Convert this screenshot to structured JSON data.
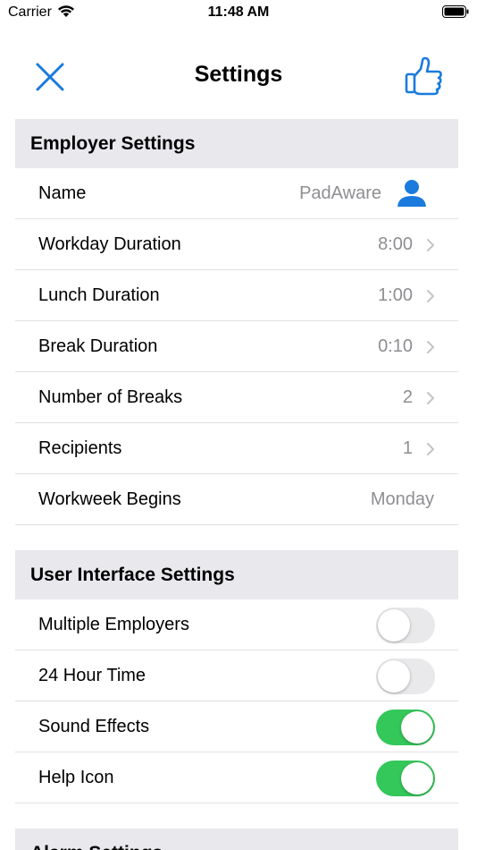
{
  "status_bar": {
    "carrier": "Carrier",
    "time": "11:48 AM"
  },
  "nav": {
    "title": "Settings",
    "close_icon": "close-icon",
    "like_icon": "thumbs-up-icon",
    "accent": "#1a7bdc"
  },
  "employer": {
    "header": "Employer Settings",
    "rows": [
      {
        "label": "Name",
        "value": "PadAware"
      },
      {
        "label": "Workday Duration",
        "value": "8:00"
      },
      {
        "label": "Lunch Duration",
        "value": "1:00"
      },
      {
        "label": "Break Duration",
        "value": "0:10"
      },
      {
        "label": "Number of Breaks",
        "value": "2"
      },
      {
        "label": "Recipients",
        "value": "1"
      },
      {
        "label": "Workweek Begins",
        "value": "Monday"
      }
    ]
  },
  "ui": {
    "header": "User Interface Settings",
    "rows": [
      {
        "label": "Multiple Employers",
        "on": false
      },
      {
        "label": "24 Hour Time",
        "on": false
      },
      {
        "label": "Sound Effects",
        "on": true
      },
      {
        "label": "Help Icon",
        "on": true
      }
    ]
  },
  "next_section": {
    "header": "Alarm Settings"
  },
  "colors": {
    "toggle_on": "#34c759",
    "toggle_off": "#e9e9eb",
    "header_bg": "#e8e8ed",
    "value_gray": "#8e8e93"
  }
}
